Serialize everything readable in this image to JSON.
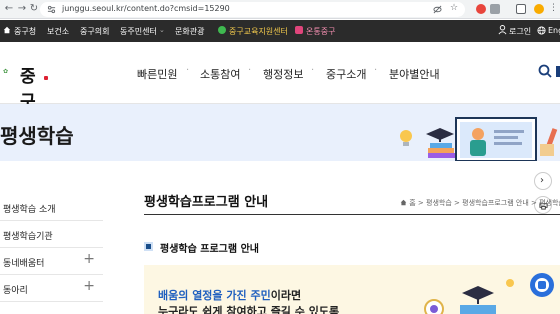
{
  "browser": {
    "url": "junggu.seoul.kr/content.do?cmsid=15290"
  },
  "topbar": {
    "items": [
      {
        "label": "중구청"
      },
      {
        "label": "보건소"
      },
      {
        "label": "중구의회"
      },
      {
        "label": "동주민센터"
      },
      {
        "label": "문화관광"
      },
      {
        "label": "중구교육지원센터"
      },
      {
        "label": "온통중구"
      }
    ],
    "login_label": "로그인",
    "lang_label": "Engl"
  },
  "header": {
    "logo_text": "중구",
    "menu": [
      {
        "label": "빠른민원"
      },
      {
        "label": "소통참여"
      },
      {
        "label": "행정정보"
      },
      {
        "label": "중구소개"
      },
      {
        "label": "분야별안내"
      }
    ]
  },
  "banner": {
    "title": "평생학습"
  },
  "sidebar": {
    "items": [
      {
        "label": "평생학습 소개",
        "expandable": false
      },
      {
        "label": "평생학습기관",
        "expandable": false
      },
      {
        "label": "동네배움터",
        "expandable": true,
        "plus": "+"
      },
      {
        "label": "동아리",
        "expandable": true,
        "plus": "+"
      }
    ]
  },
  "main": {
    "title": "평생학습프로그램 안내",
    "breadcrumb": [
      "홈",
      "평생학습",
      "평생학습프로그램 안내",
      "평생학습프로그램"
    ],
    "breadcrumb_sep": ">",
    "subtitle": "평생학습 프로그램 안내",
    "feature": {
      "highlight": "배움의 열정을 가진 주민",
      "rest": "이라면",
      "line2": "누구라도 쉽게 참여하고 즐길 수 있도록"
    }
  },
  "colors": {
    "topbar_bg": "#2b2b2b",
    "banner_bg": "#e9f0fc",
    "accent_blue": "#1f5fbf",
    "feature_bg": "#fdf7e3",
    "subtitle_icon": "#1a4e8a"
  }
}
